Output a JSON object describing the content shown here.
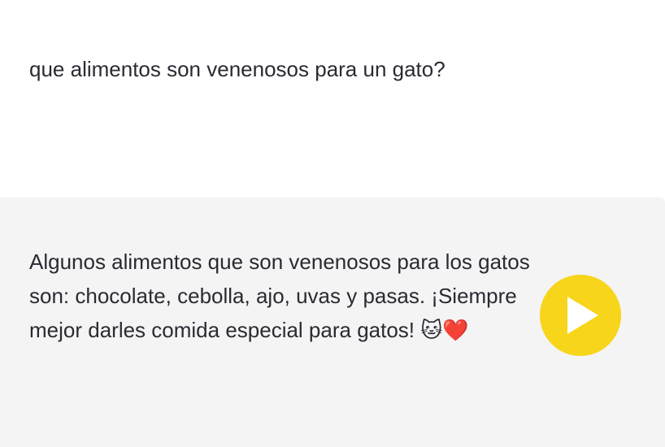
{
  "conversation": {
    "user_message": "que alimentos son venenosos para un gato?",
    "assistant_message": "Algunos alimentos que son venenosos para los gatos son: chocolate, cebolla, ajo, uvas y pasas. ¡Siempre mejor darles comida especial para gatos! 🐱❤️"
  },
  "icons": {
    "play": "play-icon"
  },
  "colors": {
    "assistant_background": "#f4f4f4",
    "play_button": "#f7d51a",
    "play_glyph": "#ffffff",
    "text": "#2a2a33"
  }
}
